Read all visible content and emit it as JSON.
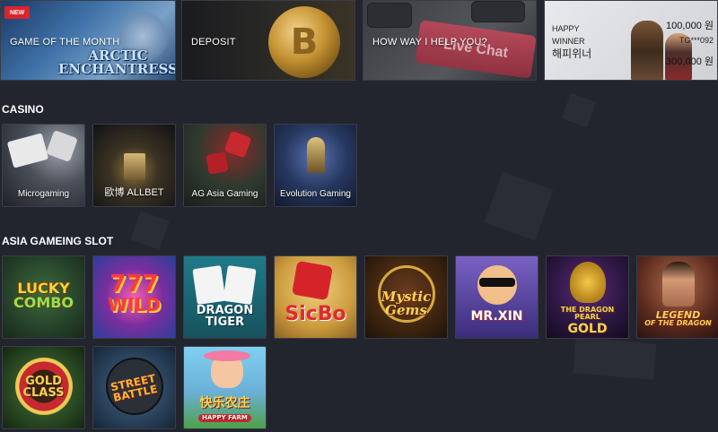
{
  "banners": {
    "game_of_month": {
      "label": "GAME OF THE MONTH",
      "badge": "NEW",
      "art_title_line1": "ARCTIC",
      "art_title_line2": "ENCHANTRESS"
    },
    "deposit": {
      "label": "DEPOSIT",
      "coin_symbol": "B"
    },
    "help": {
      "label": "HOW WAY I HELP YOU?",
      "key_text": "Live Chat"
    },
    "winner": {
      "label_line1": "HAPPY",
      "label_line2": "WINNER",
      "label_korean": "해피위너",
      "amount1": "100,000 원",
      "user": "TG***092",
      "amount2": "300,000 원"
    }
  },
  "casino": {
    "title": "CASINO",
    "providers": [
      {
        "name": "Microgaming"
      },
      {
        "name": "歐博 ALLBET"
      },
      {
        "name": "AG Asia Gaming"
      },
      {
        "name": "Evolution Gaming"
      }
    ]
  },
  "slots": {
    "title": "ASIA GAMEING SLOT",
    "games": [
      {
        "line1": "LUCKY",
        "line2": "COMBO"
      },
      {
        "line1": "777",
        "line2": "WILD"
      },
      {
        "line1": "DRAGON",
        "line2": "TIGER"
      },
      {
        "line1": "SicBo",
        "line2": ""
      },
      {
        "line1": "Mystic",
        "line2": "Gems"
      },
      {
        "line1": "MR.XIN",
        "line2": ""
      },
      {
        "line1": "THE DRAGON PEARL",
        "line2": "GOLD"
      },
      {
        "line1": "LEGEND",
        "line2": "OF THE DRAGON"
      },
      {
        "line1": "GOLD",
        "line2": "CLASS"
      },
      {
        "line1": "STREET",
        "line2": "BATTLE"
      },
      {
        "line1": "快乐农庄",
        "line2": "HAPPY FARM"
      }
    ]
  }
}
